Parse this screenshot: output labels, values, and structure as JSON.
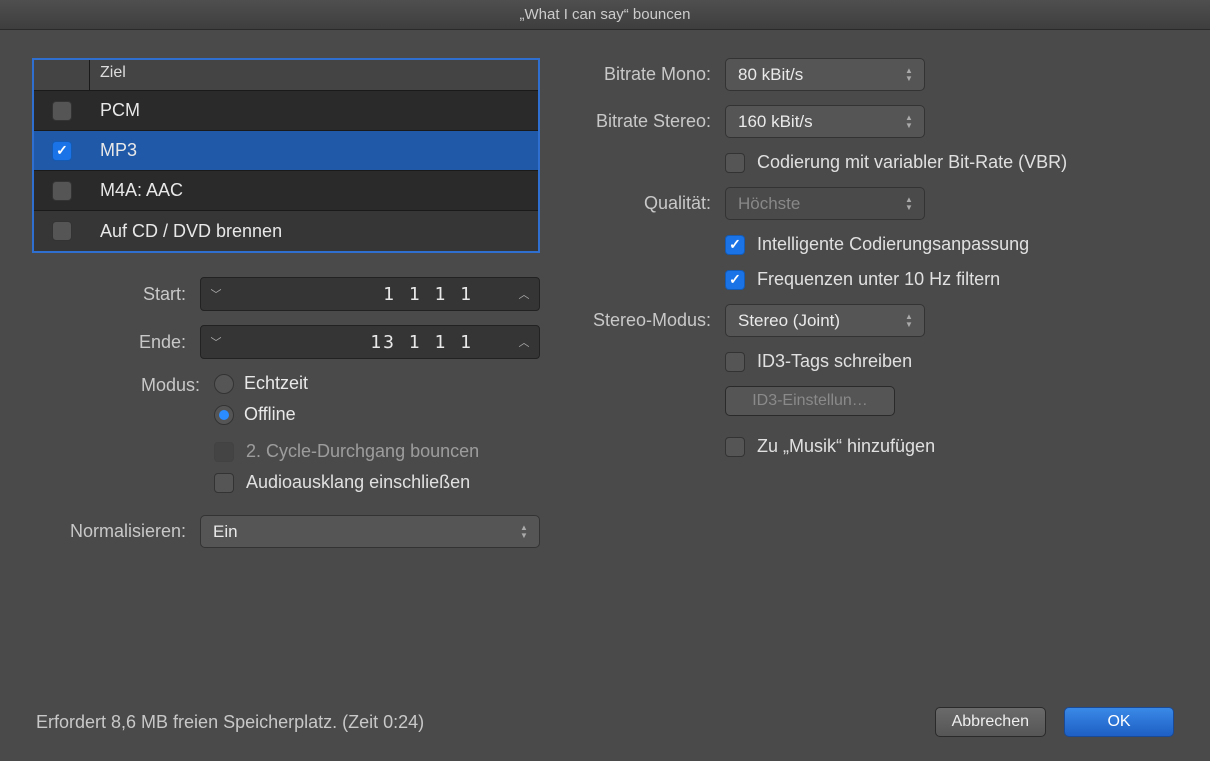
{
  "window": {
    "title": "„What I can say“ bouncen"
  },
  "dest": {
    "header": "Ziel",
    "rows": [
      {
        "label": "PCM",
        "checked": false
      },
      {
        "label": "MP3",
        "checked": true
      },
      {
        "label": "M4A: AAC",
        "checked": false
      },
      {
        "label": "Auf CD / DVD brennen",
        "checked": false
      }
    ]
  },
  "left": {
    "start_label": "Start:",
    "start_value": "1 1 1    1",
    "end_label": "Ende:",
    "end_value": "13 1 1    1",
    "modus_label": "Modus:",
    "modus_options": {
      "realtime": "Echtzeit",
      "offline": "Offline"
    },
    "modus_selected": "offline",
    "cycle2_label": "2. Cycle-Durchgang bouncen",
    "tail_label": "Audioausklang einschließen",
    "normalize_label": "Normalisieren:",
    "normalize_value": "Ein"
  },
  "right": {
    "bitrate_mono_label": "Bitrate Mono:",
    "bitrate_mono_value": "80 kBit/s",
    "bitrate_stereo_label": "Bitrate Stereo:",
    "bitrate_stereo_value": "160 kBit/s",
    "vbr_label": "Codierung mit variabler Bit-Rate (VBR)",
    "quality_label": "Qualität:",
    "quality_value": "Höchste",
    "smart_label": "Intelligente Codierungsanpassung",
    "filter_label": "Frequenzen unter 10 Hz filtern",
    "stereo_mode_label": "Stereo-Modus:",
    "stereo_mode_value": "Stereo (Joint)",
    "id3_write_label": "ID3-Tags schreiben",
    "id3_settings_label": "ID3-Einstellun…",
    "add_music_label": "Zu „Musik“ hinzufügen"
  },
  "footer": {
    "status": "Erfordert 8,6 MB freien Speicherplatz. (Zeit 0:24)",
    "cancel": "Abbrechen",
    "ok": "OK"
  }
}
